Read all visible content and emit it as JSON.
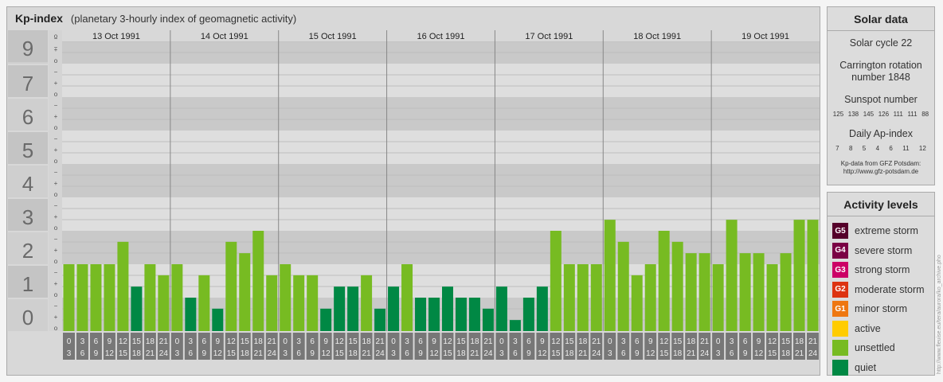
{
  "header": {
    "title": "Kp-index",
    "subtitle": "(planetary 3-hourly index of geomagnetic activity)"
  },
  "chart_data": {
    "type": "bar",
    "title": "Kp-index",
    "subtitle": "(planetary 3-hourly index of geomagnetic activity)",
    "ylim": [
      0,
      9
    ],
    "y_major_ticks": [
      "0",
      "1",
      "2",
      "3",
      "4",
      "5",
      "6",
      "7",
      "8",
      "9"
    ],
    "y_minor_ticks": [
      "o",
      "+",
      "−",
      "o"
    ],
    "days": [
      "13 Oct 1991",
      "14 Oct 1991",
      "15 Oct 1991",
      "16 Oct 1991",
      "17 Oct 1991",
      "18 Oct 1991",
      "19 Oct 1991"
    ],
    "intervals": [
      {
        "start": "0",
        "end": "3"
      },
      {
        "start": "3",
        "end": "6"
      },
      {
        "start": "6",
        "end": "9"
      },
      {
        "start": "9",
        "end": "12"
      },
      {
        "start": "12",
        "end": "15"
      },
      {
        "start": "15",
        "end": "18"
      },
      {
        "start": "18",
        "end": "21"
      },
      {
        "start": "21",
        "end": "24"
      }
    ],
    "values": [
      [
        2.0,
        2.0,
        2.0,
        2.0,
        2.67,
        1.33,
        2.0,
        1.67
      ],
      [
        2.0,
        1.0,
        1.67,
        0.67,
        2.67,
        2.33,
        3.0,
        1.67
      ],
      [
        2.0,
        1.67,
        1.67,
        0.67,
        1.33,
        1.33,
        1.67,
        0.67
      ],
      [
        1.33,
        2.0,
        1.0,
        1.0,
        1.33,
        1.0,
        1.0,
        0.67
      ],
      [
        1.33,
        0.33,
        1.0,
        1.33,
        3.0,
        2.0,
        2.0,
        2.0
      ],
      [
        3.33,
        2.67,
        1.67,
        2.0,
        3.0,
        2.67,
        2.33,
        2.33
      ],
      [
        2.0,
        3.33,
        2.33,
        2.33,
        2.0,
        2.33,
        3.33,
        3.33
      ]
    ],
    "colors": {
      "unsettled": "#77bb22",
      "quiet": "#008844"
    },
    "grid": true
  },
  "solar": {
    "heading": "Solar data",
    "cycle": "Solar cycle 22",
    "carrington_line1": "Carrington rotation",
    "carrington_line2": "number 1848",
    "sunspot_heading": "Sunspot number",
    "sunspot_numbers": [
      "125",
      "138",
      "145",
      "126",
      "111",
      "111",
      "88"
    ],
    "ap_heading": "Daily Ap-index",
    "ap_values": [
      "7",
      "8",
      "5",
      "4",
      "6",
      "11",
      "12"
    ],
    "source_line1": "Kp-data from GFZ Potsdam:",
    "source_line2": "http://www.gfz-potsdam.de"
  },
  "activity": {
    "heading": "Activity levels",
    "levels": [
      {
        "code": "G5",
        "label": "extreme storm",
        "color": "#55002a",
        "icon": "g5-badge-icon"
      },
      {
        "code": "G4",
        "label": "severe storm",
        "color": "#7a0044",
        "icon": "g4-badge-icon"
      },
      {
        "code": "G3",
        "label": "strong storm",
        "color": "#cc0066",
        "icon": "g3-badge-icon"
      },
      {
        "code": "G2",
        "label": "moderate storm",
        "color": "#dd3311",
        "icon": "g2-badge-icon"
      },
      {
        "code": "G1",
        "label": "minor storm",
        "color": "#ee7711",
        "icon": "g1-badge-icon"
      },
      {
        "code": "",
        "label": "active",
        "color": "#ffcc00",
        "icon": "active-swatch-icon"
      },
      {
        "code": "",
        "label": "unsettled",
        "color": "#77bb22",
        "icon": "unsettled-swatch-icon"
      },
      {
        "code": "",
        "label": "quiet",
        "color": "#008844",
        "icon": "quiet-swatch-icon"
      }
    ]
  },
  "watermark": "http://www.fleuise.eu/tera/aurora/ko_archive.pho"
}
